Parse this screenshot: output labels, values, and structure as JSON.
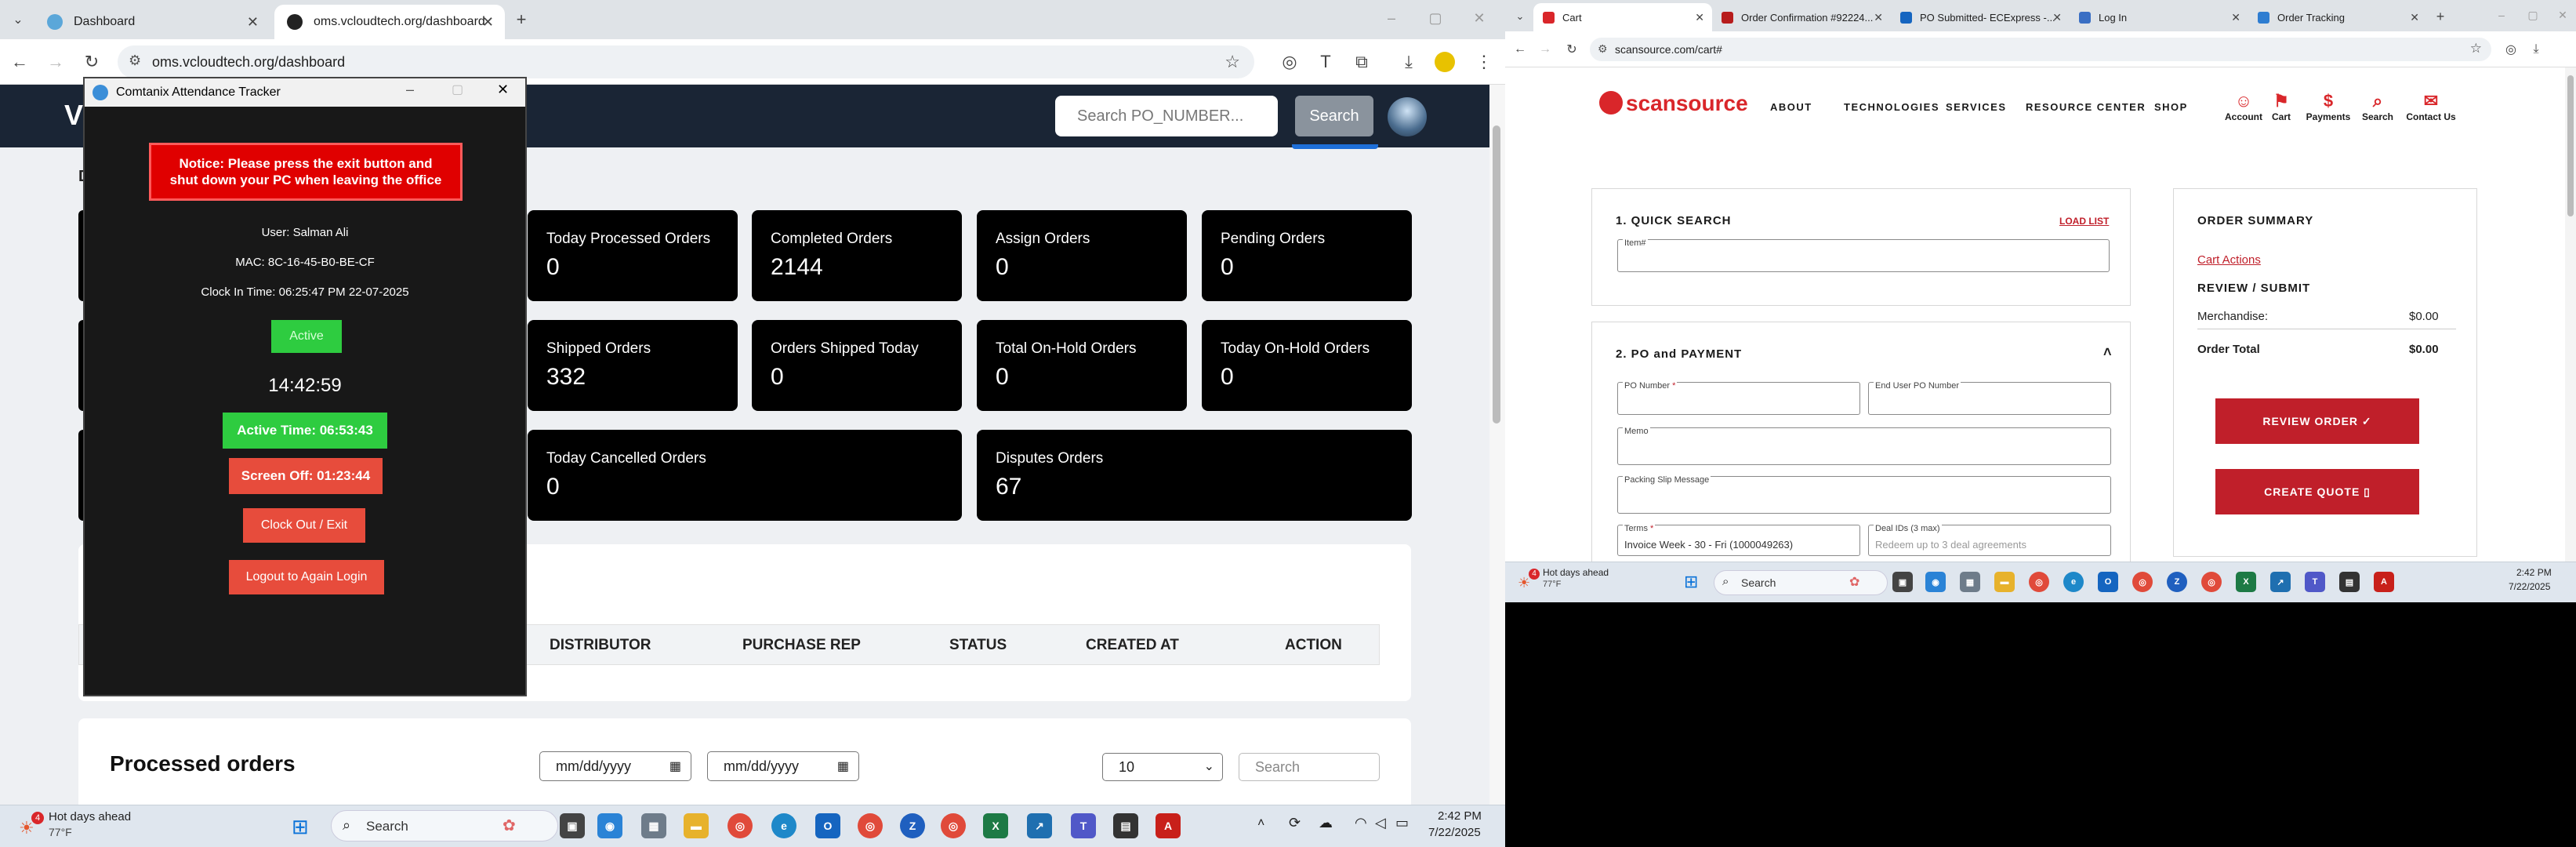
{
  "left_browser": {
    "tabs": [
      {
        "label": "Dashboard",
        "active": false
      },
      {
        "label": "oms.vcloudtech.org/dashboard",
        "active": true
      }
    ],
    "new_tab": "+",
    "url": "oms.vcloudtech.org/dashboard",
    "window_controls": [
      "–",
      "▢",
      "✕"
    ]
  },
  "oms": {
    "search_placeholder": "Search PO_NUMBER...",
    "search_button": "Search",
    "header_letter_1": "V",
    "header_letter_2": "D",
    "cards": [
      {
        "title": "Today Processed Orders",
        "value": "0"
      },
      {
        "title": "Completed Orders",
        "value": "2144"
      },
      {
        "title": "Assign Orders",
        "value": "0"
      },
      {
        "title": "Pending Orders",
        "value": "0"
      },
      {
        "title": "Shipped Orders",
        "value": "332"
      },
      {
        "title": "Orders Shipped Today",
        "value": "0"
      },
      {
        "title": "Total On-Hold Orders",
        "value": "0"
      },
      {
        "title": "Today On-Hold Orders",
        "value": "0"
      },
      {
        "title": "Today Cancelled Orders",
        "value": "0"
      },
      {
        "title": "Disputes Orders",
        "value": "67"
      }
    ],
    "table_headers": [
      "DISTRIBUTOR",
      "PURCHASE REP",
      "STATUS",
      "CREATED AT",
      "ACTION"
    ],
    "processed_title": "Processed orders",
    "date_placeholder": "mm/dd/yyyy",
    "page_size": "10",
    "table_search_placeholder": "Search"
  },
  "attendance": {
    "title": "Comtanix Attendance Tracker",
    "notice": "Notice: Please press the exit button and shut down your PC when leaving the office",
    "user": "User: Salman Ali",
    "mac": "MAC: 8C-16-45-B0-BE-CF",
    "clock_in": "Clock In Time: 06:25:47 PM 22-07-2025",
    "status": "Active",
    "clock": "14:42:59",
    "active_time": "Active Time: 06:53:43",
    "screen_off": "Screen Off: 01:23:44",
    "clock_out": "Clock Out / Exit",
    "logout": "Logout to Again Login"
  },
  "left_taskbar": {
    "weather_badge": "4",
    "weather_title": "Hot days ahead",
    "weather_temp": "77°F",
    "search": "Search",
    "time": "2:42 PM",
    "date": "7/22/2025"
  },
  "right_browser": {
    "tabs": [
      {
        "label": "Cart",
        "active": true
      },
      {
        "label": "Order Confirmation #92224...",
        "active": false
      },
      {
        "label": "PO Submitted- ECExpress -...",
        "active": false
      },
      {
        "label": "Log In",
        "active": false
      },
      {
        "label": "Order Tracking",
        "active": false
      }
    ],
    "url": "scansource.com/cart#"
  },
  "scansource": {
    "logo": "scansource",
    "nav": [
      "ABOUT",
      "TECHNOLOGIES",
      "SERVICES",
      "RESOURCE CENTER",
      "SHOP"
    ],
    "icons": [
      "Account",
      "Cart",
      "Payments",
      "Search",
      "Contact Us"
    ],
    "quick_search_title": "1. QUICK SEARCH",
    "load_list": "LOAD LIST",
    "item_label": "Item#",
    "po_title": "2. PO and PAYMENT",
    "po_number_label": "PO Number",
    "end_user_po_label": "End User PO Number",
    "memo_label": "Memo",
    "packing_label": "Packing Slip Message",
    "terms_label": "Terms",
    "terms_value": "Invoice Week - 30 - Fri (1000049263)",
    "deal_label": "Deal IDs (3 max)",
    "deal_placeholder": "Redeem up to 3 deal agreements",
    "summary_title": "ORDER SUMMARY",
    "cart_actions": "Cart Actions",
    "review_title": "REVIEW / SUBMIT",
    "merch_label": "Merchandise:",
    "merch_value": "$0.00",
    "total_label": "Order Total",
    "total_value": "$0.00",
    "review_button": "REVIEW ORDER ✓",
    "quote_button": "CREATE QUOTE ▯"
  },
  "right_taskbar": {
    "weather_badge": "4",
    "weather_title": "Hot days ahead",
    "weather_temp": "77°F",
    "search": "Search",
    "time": "2:42 PM",
    "date": "7/22/2025"
  },
  "colors": {
    "accent_red": "#d9262a",
    "oms_card": "#000000",
    "active_green": "#2ecc40",
    "danger_red": "#e74c3c"
  }
}
